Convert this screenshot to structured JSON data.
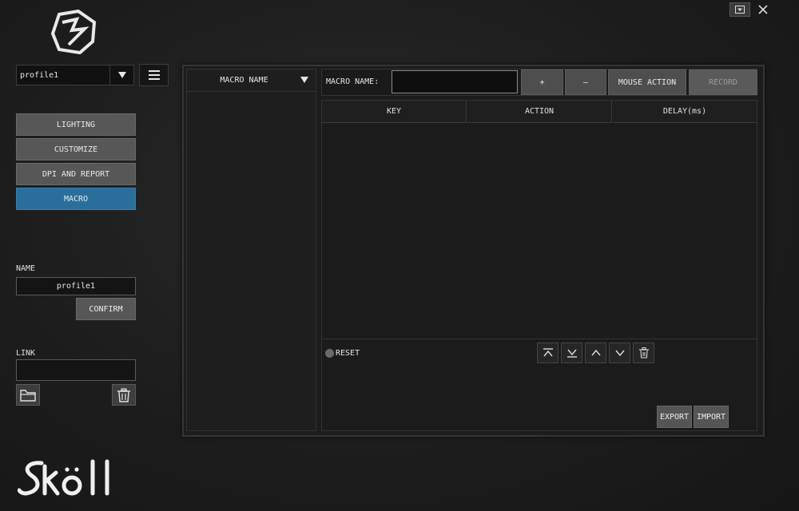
{
  "window": {
    "minimize_icon": "dropdown-box-icon",
    "close_icon": "close-icon"
  },
  "sidebar": {
    "profile": {
      "selected": "profile1"
    },
    "nav": [
      {
        "label": "LIGHTING",
        "active": false
      },
      {
        "label": "CUSTOMIZE",
        "active": false
      },
      {
        "label": "DPI AND REPORT",
        "active": false
      },
      {
        "label": "MACRO",
        "active": true
      }
    ],
    "name_label": "NAME",
    "name_value": "profile1",
    "confirm_label": "CONFIRM",
    "link_label": "LINK",
    "link_value": "",
    "accent_color": "#2a6f9c"
  },
  "macro": {
    "list_header": "MACRO NAME",
    "name_label": "MACRO NAME:",
    "name_value": "",
    "add_label": "+",
    "remove_label": "–",
    "mouse_action_label": "MOUSE ACTION",
    "record_label": "RECORD",
    "columns": [
      "KEY",
      "ACTION",
      "DELAY(ms)"
    ],
    "rows": [],
    "reset_label": "RESET",
    "export_label": "EXPORT",
    "import_label": "IMPORT"
  }
}
